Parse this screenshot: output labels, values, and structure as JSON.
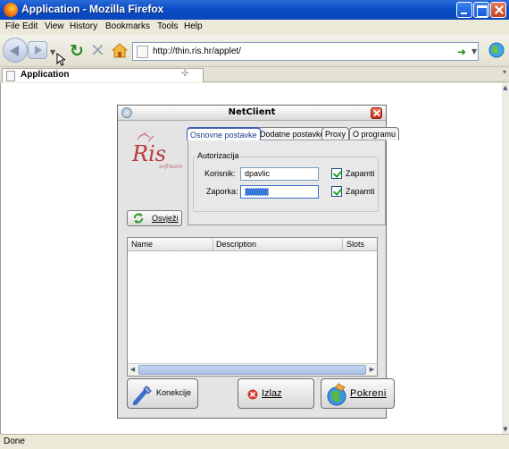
{
  "browser": {
    "window_title": "Application - Mozilla Firefox",
    "menu": [
      "File",
      "Edit",
      "View",
      "History",
      "Bookmarks",
      "Tools",
      "Help"
    ],
    "url": "http://thin.ris.hr/applet/",
    "tab_label": "Application",
    "status_text": "Done"
  },
  "applet": {
    "title": "NetClient",
    "tabs": [
      "Osnovne postavke",
      "Dodatne postavke",
      "Proxy",
      "O programu"
    ],
    "active_tab": "Osnovne postavke",
    "auth_legend": "Autorizacija",
    "username_label": "Korisnik:",
    "username_value": "dpavlic",
    "password_label": "Zaporka:",
    "remember_label_1": "Zapamti",
    "remember_label_2": "Zapamti",
    "remember_user_checked": true,
    "remember_pass_checked": true,
    "refresh_label": "Osvježi",
    "table_headers": [
      "Name",
      "Description",
      "Slots"
    ],
    "table_rows": [],
    "buttons": {
      "connections": "Konekcije",
      "exit": "Izlaz",
      "launch": "Pokreni"
    },
    "logo": {
      "text": "Ris",
      "sub_text": "software"
    }
  },
  "colors": {
    "titlebar_blue": "#0a4ec7",
    "active_tab_blue": "#3a5bb0",
    "logo_red": "#b83a3a"
  }
}
